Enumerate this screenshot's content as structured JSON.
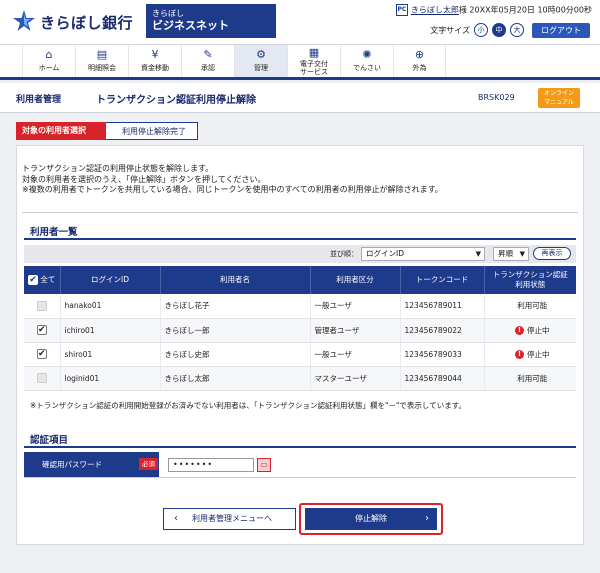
{
  "header": {
    "bank_name": "きらぼし銀行",
    "service_line1": "きらぼし",
    "service_line2": "ビジネスネット",
    "user_icon": "PC",
    "user_name": "きらぼし太郎",
    "user_suffix": "様",
    "last_login": "20XX年05月20日 10時00分00秒",
    "font_size_label": "文字サイズ",
    "font_small": "小",
    "font_medium": "中",
    "font_large": "大",
    "logout_label": "ログアウト",
    "brand_color": "#1e3a8a"
  },
  "nav": [
    {
      "label": "ホーム",
      "icon": "home-icon",
      "glyph": "⌂"
    },
    {
      "label": "明細照会",
      "icon": "document-icon",
      "glyph": "▤"
    },
    {
      "label": "資金移動",
      "icon": "yen-icon",
      "glyph": "¥"
    },
    {
      "label": "承認",
      "icon": "approve-icon",
      "glyph": "✎"
    },
    {
      "label": "管理",
      "icon": "admin-icon",
      "glyph": "⚙"
    },
    {
      "label": "電子交付\nサービス",
      "icon": "delivery-icon",
      "glyph": "▦"
    },
    {
      "label": "でんさい",
      "icon": "densai-icon",
      "glyph": "✺"
    },
    {
      "label": "外為",
      "icon": "globe-icon",
      "glyph": "⊕"
    }
  ],
  "page": {
    "category": "利用者管理",
    "title": "トランザクション認証利用停止解除",
    "code": "BRSK029",
    "manual_line1": "オンライン",
    "manual_line2": "マニュアル"
  },
  "steps": {
    "step1": "対象の利用者選択",
    "step2": "利用停止解除完了"
  },
  "notice": {
    "line1": "トランザクション認証の利用停止状態を解除します。",
    "line2": "対象の利用者を選択のうえ、「停止解除」ボタンを押してください。",
    "line3": "※複数の利用者でトークンを共用している場合、同じトークンを使用中のすべての利用者の利用停止が解除されます。"
  },
  "users_section": {
    "title": "利用者一覧",
    "sort_label": "並び順：",
    "sort_value": "ログインID",
    "order_value": "昇順",
    "redisplay_label": "再表示",
    "columns": {
      "all": "全て",
      "login_id": "ログインID",
      "name": "利用者名",
      "type": "利用者区分",
      "token": "トークンコード",
      "status": "トランザクション認証\n利用状態"
    },
    "rows": [
      {
        "login_id": "hanako01",
        "name": "きらぼし花子",
        "type": "一般ユーザ",
        "token": "123456789011",
        "status": "利用可能",
        "checked": false,
        "disabled": true,
        "stopped": false
      },
      {
        "login_id": "ichiro01",
        "name": "きらぼし一郎",
        "type": "管理者ユーザ",
        "token": "123456789022",
        "status": "停止中",
        "checked": true,
        "disabled": false,
        "stopped": true
      },
      {
        "login_id": "shiro01",
        "name": "きらぼし史郎",
        "type": "一般ユーザ",
        "token": "123456789033",
        "status": "停止中",
        "checked": true,
        "disabled": false,
        "stopped": true
      },
      {
        "login_id": "loginid01",
        "name": "きらぼし太郎",
        "type": "マスターユーザ",
        "token": "123456789044",
        "status": "利用可能",
        "checked": false,
        "disabled": true,
        "stopped": false
      }
    ],
    "footnote": "※トランザクション認証の利用開始登録がお済みでない利用者は、「トランザクション認証利用状態」欄を\"－\"で表示しています。"
  },
  "auth_section": {
    "title": "認証項目",
    "password_label": "確認用パスワード",
    "required_label": "必須",
    "password_value": "•••••••"
  },
  "buttons": {
    "back_label": "利用者管理メニューへ",
    "submit_label": "停止解除"
  }
}
